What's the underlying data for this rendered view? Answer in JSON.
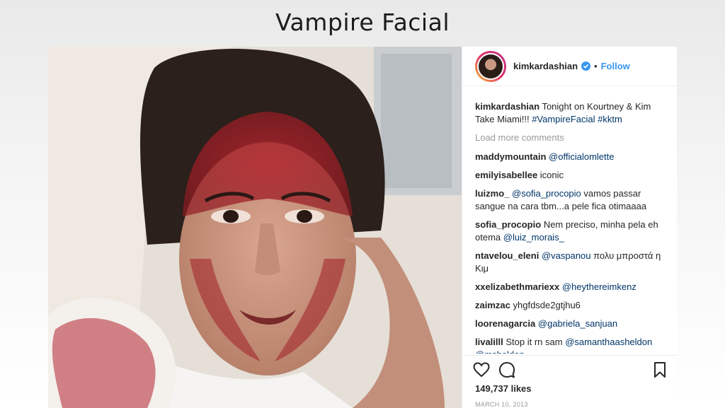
{
  "slide": {
    "title": "Vampire Facial"
  },
  "post": {
    "username": "kimkardashian",
    "separator": "•",
    "follow_label": "Follow",
    "caption": {
      "user": "kimkardashian",
      "text": "Tonight on Kourtney & Kim Take Miami!!! ",
      "hashtags": "#VampireFacial #kktm"
    },
    "load_more": "Load more comments",
    "comments": [
      {
        "user": "maddymountain",
        "mention": "@officialomlette",
        "text": ""
      },
      {
        "user": "emilyisabellee",
        "mention": "",
        "text": "iconic"
      },
      {
        "user": "luizmo_",
        "mention": "@sofia_procopio",
        "text": " vamos passar sangue na cara tbm...a pele fica otimaaaa"
      },
      {
        "user": "sofia_procopio",
        "mention": "",
        "text": "Nem preciso, minha pela eh otema ",
        "mention_after": "@luiz_morais_"
      },
      {
        "user": "ntavelou_eleni",
        "mention": "@vaspanou",
        "text": " πολυ μπροστά η Κιμ"
      },
      {
        "user": "xxelizabethmariexx",
        "mention": "@heythereimkenz",
        "text": ""
      },
      {
        "user": "zaimzac",
        "mention": "",
        "text": "yhgfdsde2gtjhu6"
      },
      {
        "user": "loorenagarcia",
        "mention": "@gabriela_sanjuan",
        "text": ""
      },
      {
        "user": "livalilll",
        "mention": "",
        "text": "Stop it rn sam ",
        "mention_after": "@samanthaasheldon @msheldon_"
      }
    ],
    "likes": "149,737 likes",
    "date": "MARCH 10, 2013",
    "icons": {
      "like": "heart-icon",
      "comment": "comment-bubble-icon",
      "save": "bookmark-icon"
    },
    "colors": {
      "link": "#003569",
      "follow": "#3897f0",
      "verified": "#3897f0"
    }
  }
}
